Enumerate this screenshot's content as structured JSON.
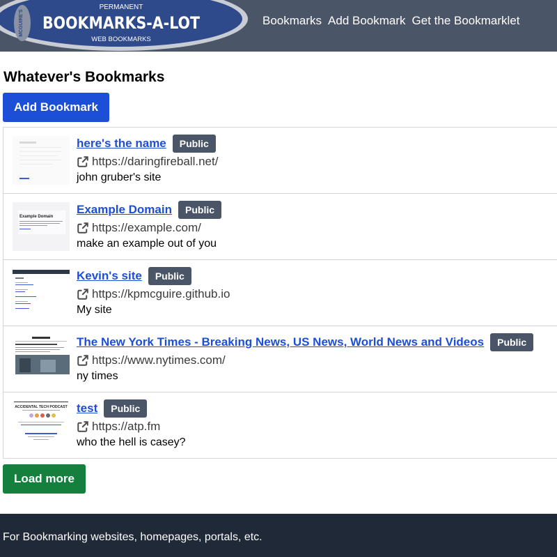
{
  "logo": {
    "top_text": "PERMANENT",
    "main_text": "BOOKMARKS-A-LOT",
    "bottom_text": "WEB BOOKMARKS",
    "seal_text": "MCGUIRE'S",
    "colors": {
      "navy": "#2e4a8a",
      "silver": "#c8ccd4"
    }
  },
  "nav": {
    "items": [
      "Bookmarks",
      "Add Bookmark",
      "Get the Bookmarklet"
    ]
  },
  "page": {
    "title": "Whatever's Bookmarks",
    "add_button": "Add Bookmark",
    "load_more_button": "Load more"
  },
  "bookmarks": [
    {
      "title": "here's the name",
      "badge": "Public",
      "url": "https://daringfireball.net/",
      "description": "john gruber's site",
      "thumbnail": "daringfireball-thumbnail"
    },
    {
      "title": "Example Domain",
      "badge": "Public",
      "url": "https://example.com/",
      "description": "make an example out of you",
      "thumbnail": "example-domain-thumbnail",
      "thumbnail_text": "Example Domain"
    },
    {
      "title": "Kevin's site",
      "badge": "Public",
      "url": "https://kpmcguire.github.io",
      "description": "My site",
      "thumbnail": "kevins-site-thumbnail"
    },
    {
      "title": "The New York Times - Breaking News, US News, World News and Videos",
      "badge": "Public",
      "url": "https://www.nytimes.com/",
      "description": "ny times",
      "thumbnail": "nytimes-thumbnail"
    },
    {
      "title": "test",
      "badge": "Public",
      "url": "https://atp.fm",
      "description": "who the hell is casey?",
      "thumbnail": "atp-thumbnail",
      "thumbnail_text": "ACCIDENTAL TECH PODCAST"
    }
  ],
  "icons": {
    "external_link": "external-link-icon"
  },
  "footer": {
    "text": "For Bookmarking websites, homepages, portals, etc."
  },
  "colors": {
    "header_bg": "#4a5568",
    "primary_button": "#1d4ed8",
    "success_button": "#15803d",
    "badge_bg": "#4a5568",
    "footer_bg": "#1f2937",
    "link": "#1d4ed8"
  }
}
